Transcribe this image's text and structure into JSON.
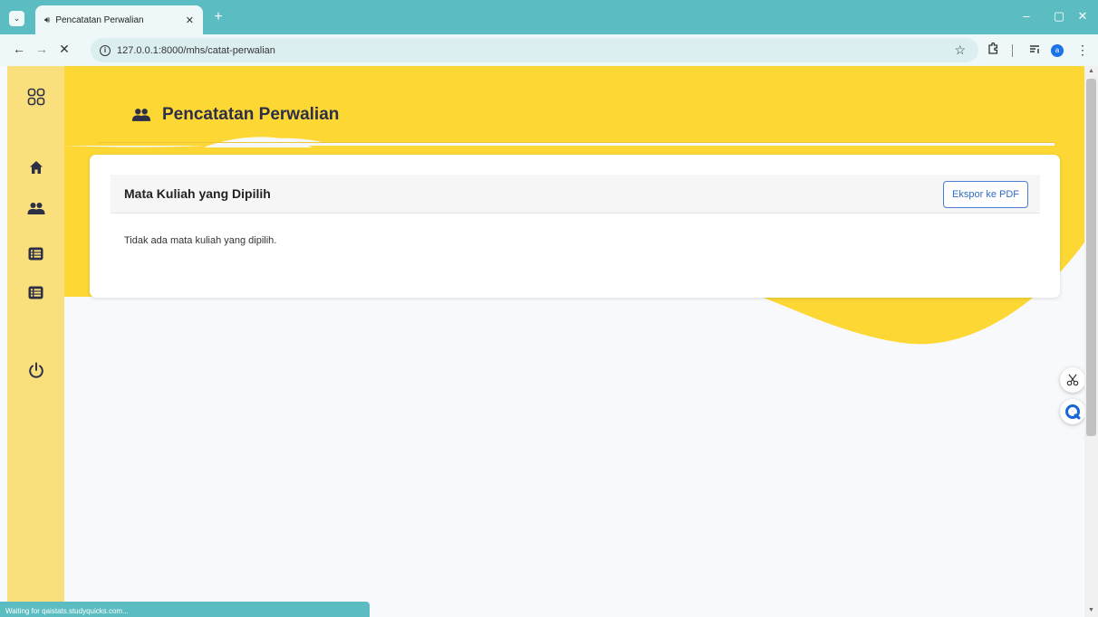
{
  "browser": {
    "tab_title": "Pencatatan Perwalian",
    "url": "127.0.0.1:8000/mhs/catat-perwalian",
    "status_text": "Waiting for qaistats.studyquicks.com...",
    "profile_initial": "a"
  },
  "page": {
    "heading": "Pencatatan Perwalian",
    "card": {
      "title": "Mata Kuliah yang Dipilih",
      "export_label": "Ekspor ke PDF",
      "empty_message": "Tidak ada mata kuliah yang dipilih."
    }
  },
  "sidebar": {
    "items": [
      {
        "icon": "grid-icon"
      },
      {
        "icon": "home-icon"
      },
      {
        "icon": "users-icon"
      },
      {
        "icon": "list-icon"
      },
      {
        "icon": "list-icon"
      },
      {
        "icon": "power-icon"
      }
    ]
  },
  "colors": {
    "accent_yellow": "#fdd835",
    "sidebar_yellow": "#f9e07d",
    "navy": "#2d2f47",
    "browser_teal": "#5bbcc1",
    "button_blue": "#2f6bc6"
  }
}
